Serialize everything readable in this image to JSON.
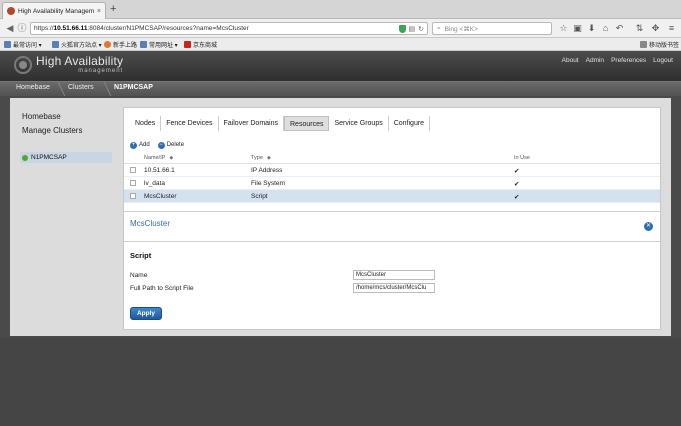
{
  "browser": {
    "tab_title": "High Availability Managem...",
    "tab_close": "×",
    "new_tab": "+",
    "url_prefix": "https://",
    "url_host": "10.51.66.11",
    "url_path": ":8084/cluster/N1PMCSAP/resources?name=McsCluster",
    "search_placeholder": "Bing <⌘K>",
    "bookmarks": [
      "最常访问 ▾",
      "火狐官方站点 ▾",
      "新手上路",
      "常用网址 ▾",
      "京东商城"
    ],
    "mobile_bookmarks": "移动版书签"
  },
  "app": {
    "title": "High Availability",
    "subtitle": "management",
    "top_links": [
      "About",
      "Admin",
      "Preferences",
      "Logout"
    ]
  },
  "breadcrumb": [
    "Homebase",
    "Clusters",
    "N1PMCSAP"
  ],
  "left_nav": {
    "items": [
      "Homebase",
      "Manage Clusters"
    ],
    "cluster": "N1PMCSAP"
  },
  "tabs": [
    "Nodes",
    "Fence Devices",
    "Failover Domains",
    "Resources",
    "Service Groups",
    "Configure"
  ],
  "active_tab": "Resources",
  "actions": {
    "add": "Add",
    "delete": "Delete"
  },
  "resources_table": {
    "columns": [
      "Name/IP",
      "Type",
      "In Use"
    ],
    "rows": [
      {
        "name": "10.51.66.1",
        "type": "IP Address",
        "in_use": "✔"
      },
      {
        "name": "lv_data",
        "type": "File System",
        "in_use": "✔"
      },
      {
        "name": "McsCluster",
        "type": "Script",
        "in_use": "✔"
      }
    ]
  },
  "detail": {
    "title": "McsCluster",
    "section": "Script",
    "fields": [
      {
        "label": "Name",
        "value": "McsCluster"
      },
      {
        "label": "Full Path to Script File",
        "value": "/home/mcs/cluster/McsClu"
      }
    ],
    "apply_label": "Apply"
  },
  "colors": {
    "accent": "#2b6fb3",
    "selected_row": "#d4e1ee",
    "status_green": "#4caa2d"
  }
}
